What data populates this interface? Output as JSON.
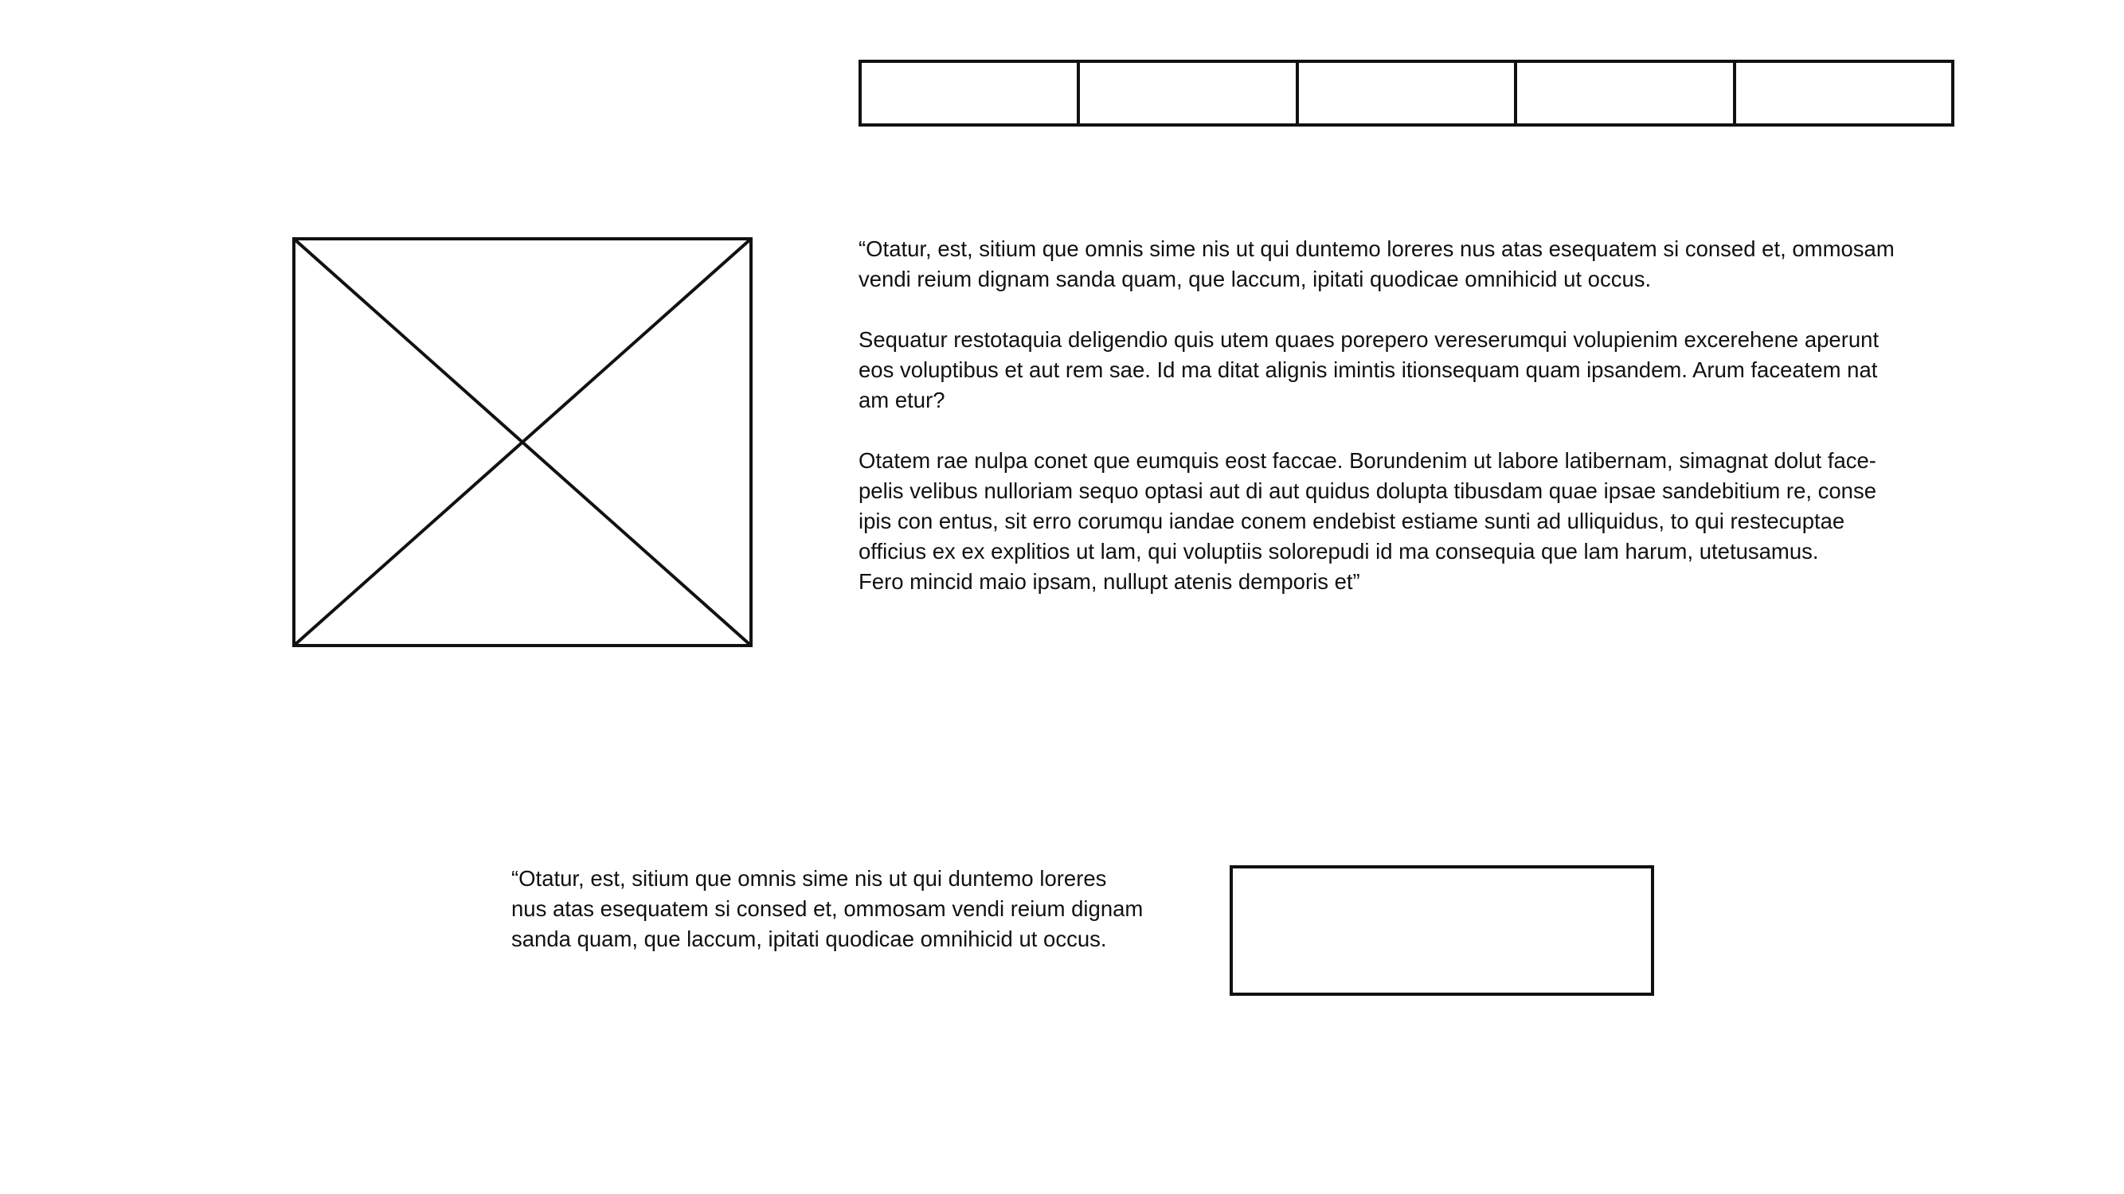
{
  "nav": {
    "items": [
      "",
      "",
      "",
      "",
      ""
    ]
  },
  "main": {
    "paragraphs": [
      "“Otatur, est, sitium que omnis sime nis ut qui duntemo loreres nus atas esequatem si consed et, ommosam\nvendi reium dignam sanda quam, que laccum, ipitati quodicae omnihicid ut occus.",
      "Sequatur restotaquia deligendio quis utem quaes porepero vereserumqui volupienim excerehene aperunt\neos voluptibus et aut rem sae. Id ma ditat alignis imintis itionsequam quam ipsandem. Arum faceatem nat\nam etur?",
      "Otatem rae nulpa conet que eumquis eost faccae. Borundenim ut labore latibernam, simagnat dolut face-\npelis velibus nulloriam sequo optasi aut di aut quidus dolupta tibusdam quae ipsae sandebitium re, conse\nipis con entus, sit erro corumqu iandae conem endebist estiame sunti ad ulliquidus, to qui restecuptae\nofficius ex ex explitios ut lam, qui voluptiis solorepudi id ma consequia que lam harum, utetusamus.\nFero mincid maio ipsam, nullupt atenis demporis et”"
    ]
  },
  "bottom": {
    "quote": "“Otatur, est, sitium que omnis sime nis ut qui duntemo loreres\nnus atas esequatem si consed et, ommosam vendi reium dignam\nsanda quam, que laccum, ipitati quodicae omnihicid ut occus."
  }
}
